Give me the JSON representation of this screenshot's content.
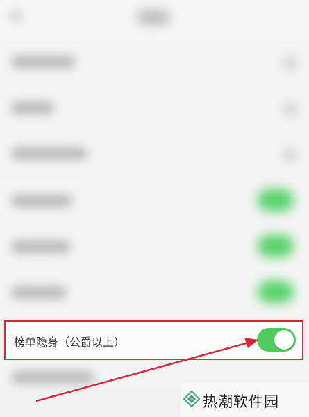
{
  "focused_setting": {
    "label": "榜单隐身（公爵以上）",
    "toggle_on": true,
    "toggle_color": "#4fca5d"
  },
  "highlight_color": "#d5293f",
  "watermark": {
    "text": "热潮软件园",
    "logo_icon": "diamond-logo-icon"
  }
}
